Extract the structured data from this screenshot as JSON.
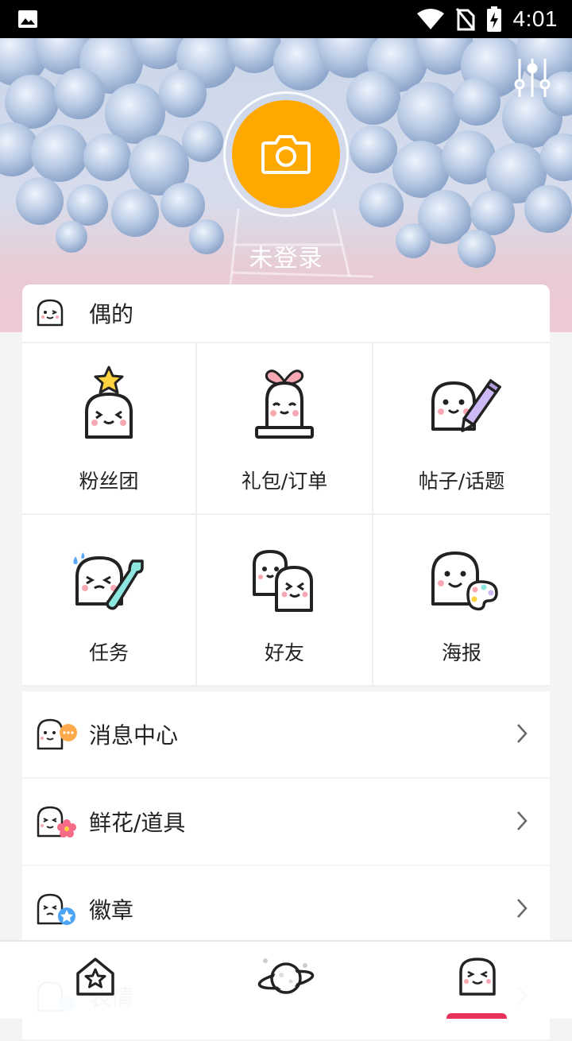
{
  "status_bar": {
    "time": "4:01",
    "icons": [
      "image-icon",
      "wifi-icon",
      "no-sim-icon",
      "battery-charging-icon"
    ]
  },
  "header": {
    "login_label": "未登录",
    "avatar_icon": "camera-icon",
    "settings_icon": "sliders-icon",
    "accent": "#ffa800"
  },
  "section": {
    "title": "偶的",
    "icon": "ghost-icon"
  },
  "grid": [
    {
      "label": "粉丝团",
      "icon": "fan-club-icon"
    },
    {
      "label": "礼包/订单",
      "icon": "gift-order-icon"
    },
    {
      "label": "帖子/话题",
      "icon": "post-topic-icon"
    },
    {
      "label": "任务",
      "icon": "task-icon"
    },
    {
      "label": "好友",
      "icon": "friends-icon"
    },
    {
      "label": "海报",
      "icon": "poster-icon"
    }
  ],
  "list": [
    {
      "label": "消息中心",
      "icon": "message-icon"
    },
    {
      "label": "鲜花/道具",
      "icon": "flower-icon"
    },
    {
      "label": "徽章",
      "icon": "badge-icon"
    },
    {
      "label": "表情",
      "icon": "emoji-icon"
    }
  ],
  "bottom_nav": [
    {
      "icon": "home-icon"
    },
    {
      "icon": "planet-icon"
    },
    {
      "icon": "me-ghost-icon",
      "active": true
    }
  ],
  "colors": {
    "indicator": "#e8325a",
    "pink_cheek": "#f7a8b2"
  }
}
